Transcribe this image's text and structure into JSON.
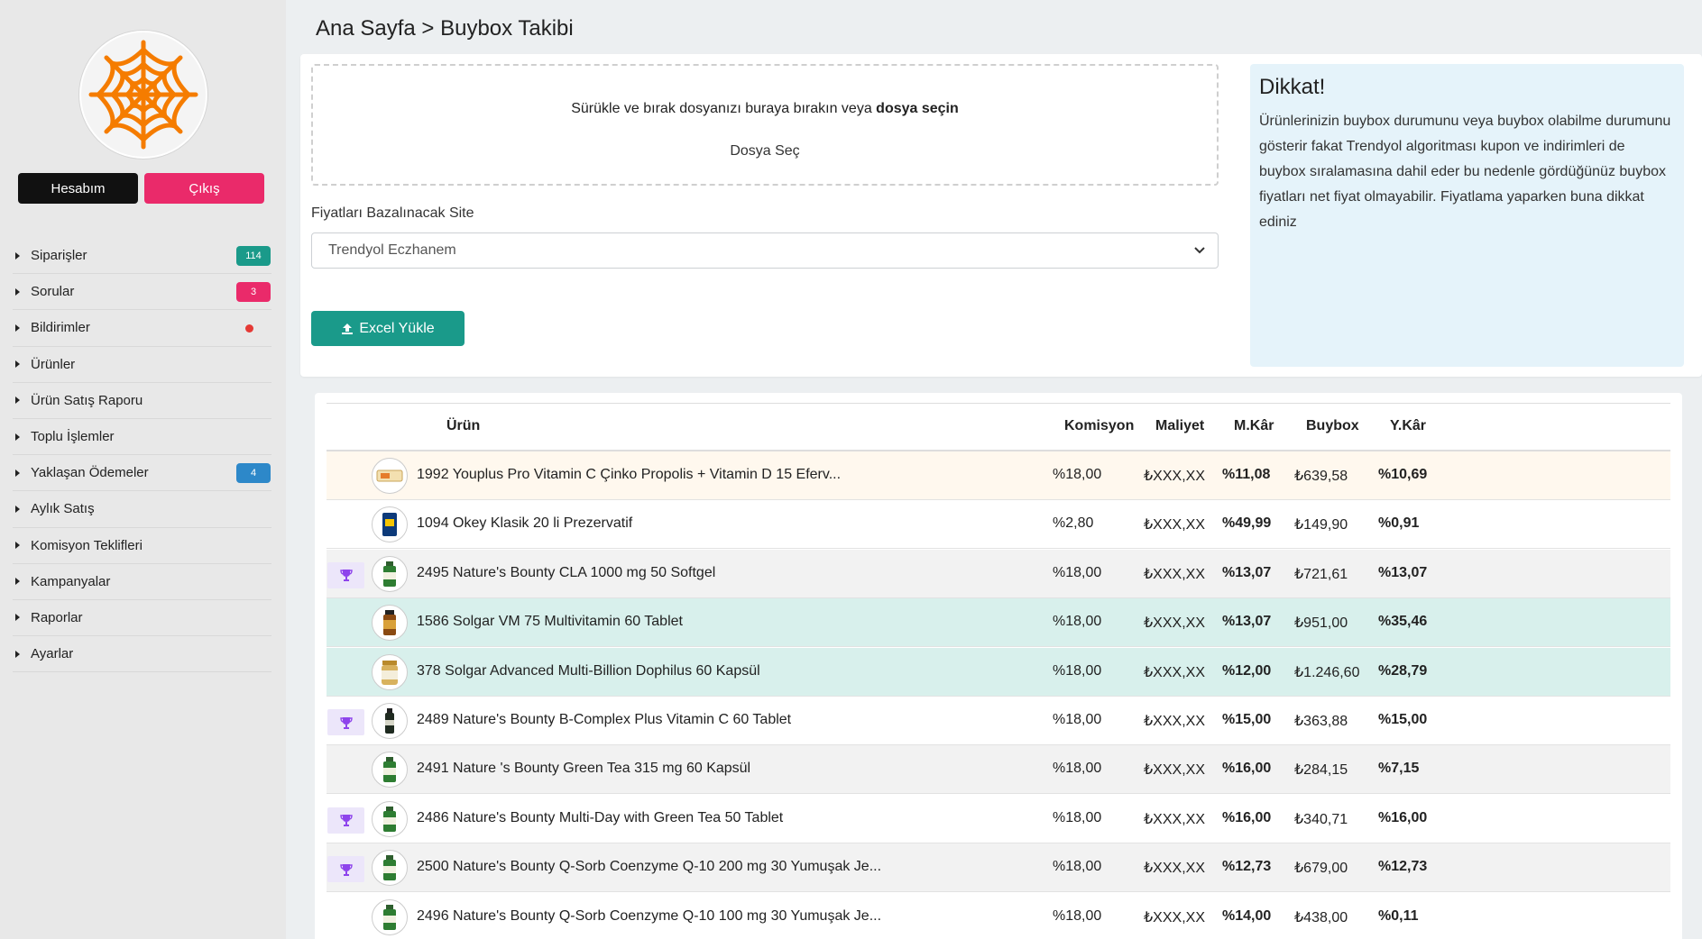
{
  "breadcrumb": "Ana Sayfa > Buybox Takibi",
  "account": {
    "account_label": "Hesabım",
    "logout_label": "Çıkış"
  },
  "menu": [
    {
      "label": "Siparişler",
      "badge": "114",
      "badge_color": "#1a9a8a"
    },
    {
      "label": "Sorular",
      "badge": "3",
      "badge_color": "#ea2a6a"
    },
    {
      "label": "Bildirimler",
      "dot": true
    },
    {
      "label": "Ürünler"
    },
    {
      "label": "Ürün Satış Raporu"
    },
    {
      "label": "Toplu İşlemler"
    },
    {
      "label": "Yaklaşan Ödemeler",
      "badge": "4",
      "badge_color": "#2d88c9"
    },
    {
      "label": "Aylık Satış"
    },
    {
      "label": "Komisyon Teklifleri"
    },
    {
      "label": "Kampanyalar"
    },
    {
      "label": "Raporlar"
    },
    {
      "label": "Ayarlar"
    }
  ],
  "upload": {
    "drop_text": "Sürükle ve bırak dosyanızı buraya bırakın veya ",
    "drop_text_bold": "dosya seçin",
    "choose_label": "Dosya Seç",
    "site_label": "Fiyatları Bazalınacak Site",
    "site_value": "Trendyol Eczhanem",
    "excel_button": "Excel Yükle"
  },
  "notice": {
    "title": "Dikkat!",
    "body": "Ürünlerinizin buybox durumunu veya buybox olabilme durumunu gösterir fakat Trendyol algoritması kupon ve indirimleri de buybox sıralamasına dahil eder bu nedenle gördüğünüz buybox fiyatları net fiyat olmayabilir. Fiyatlama yaparken buna dikkat ediniz"
  },
  "table": {
    "headers": {
      "product": "Ürün",
      "commission": "Komisyon",
      "cost": "Maliyet",
      "mprofit": "M.Kâr",
      "buybox": "Buybox",
      "yprofit": "Y.Kâr"
    },
    "rows": [
      {
        "product": "1992 Youplus Pro Vitamin C Çinko Propolis + Vitamin D 15 Eferv...",
        "commission": "%18,00",
        "cost": "₺XXX,XX",
        "mprofit": "%11,08",
        "buybox": "₺639,58",
        "yprofit": "%10,69",
        "trophy": false,
        "bg": "#fff8ee",
        "thumb": "box"
      },
      {
        "product": "1094 Okey Klasik 20 li Prezervatif",
        "commission": "%2,80",
        "cost": "₺XXX,XX",
        "mprofit": "%49,99",
        "buybox": "₺149,90",
        "yprofit": "%0,91",
        "trophy": false,
        "bg": "#ffffff",
        "thumb": "pack"
      },
      {
        "product": "2495 Nature's Bounty CLA 1000 mg 50 Softgel",
        "commission": "%18,00",
        "cost": "₺XXX,XX",
        "mprofit": "%13,07",
        "buybox": "₺721,61",
        "yprofit": "%13,07",
        "trophy": true,
        "bg": "#f2f2f2",
        "thumb": "bottle-green"
      },
      {
        "product": "1586 Solgar VM 75 Multivitamin 60 Tablet",
        "commission": "%18,00",
        "cost": "₺XXX,XX",
        "mprofit": "%13,07",
        "buybox": "₺951,00",
        "yprofit": "%35,46",
        "trophy": false,
        "bg": "#d8f0ec",
        "thumb": "bottle-amber"
      },
      {
        "product": "378 Solgar Advanced Multi-Billion Dophilus 60 Kapsül",
        "commission": "%18,00",
        "cost": "₺XXX,XX",
        "mprofit": "%12,00",
        "buybox": "₺1.246,60",
        "yprofit": "%28,79",
        "trophy": false,
        "bg": "#d8f0ec",
        "thumb": "jar-gold"
      },
      {
        "product": "2489 Nature's Bounty B-Complex Plus Vitamin C 60 Tablet",
        "commission": "%18,00",
        "cost": "₺XXX,XX",
        "mprofit": "%15,00",
        "buybox": "₺363,88",
        "yprofit": "%15,00",
        "trophy": true,
        "bg": "#ffffff",
        "thumb": "bottle-dark"
      },
      {
        "product": "2491 Nature 's Bounty Green Tea 315 mg 60 Kapsül",
        "commission": "%18,00",
        "cost": "₺XXX,XX",
        "mprofit": "%16,00",
        "buybox": "₺284,15",
        "yprofit": "%7,15",
        "trophy": false,
        "bg": "#f2f2f2",
        "thumb": "bottle-green"
      },
      {
        "product": "2486 Nature's Bounty Multi-Day with Green Tea 50 Tablet",
        "commission": "%18,00",
        "cost": "₺XXX,XX",
        "mprofit": "%16,00",
        "buybox": "₺340,71",
        "yprofit": "%16,00",
        "trophy": true,
        "bg": "#ffffff",
        "thumb": "bottle-green"
      },
      {
        "product": "2500 Nature's Bounty Q-Sorb Coenzyme Q-10 200 mg 30 Yumuşak Je...",
        "commission": "%18,00",
        "cost": "₺XXX,XX",
        "mprofit": "%12,73",
        "buybox": "₺679,00",
        "yprofit": "%12,73",
        "trophy": true,
        "bg": "#f2f2f2",
        "thumb": "bottle-green"
      },
      {
        "product": "2496 Nature's Bounty Q-Sorb Coenzyme Q-10 100 mg 30 Yumuşak Je...",
        "commission": "%18,00",
        "cost": "₺XXX,XX",
        "mprofit": "%14,00",
        "buybox": "₺438,00",
        "yprofit": "%0,11",
        "trophy": false,
        "bg": "#ffffff",
        "thumb": "bottle-green"
      }
    ]
  },
  "colors": {
    "accent": "#1a9a8a",
    "danger": "#ea2a6a",
    "logo": "#f57c00",
    "trophy": "#8e44ec"
  }
}
